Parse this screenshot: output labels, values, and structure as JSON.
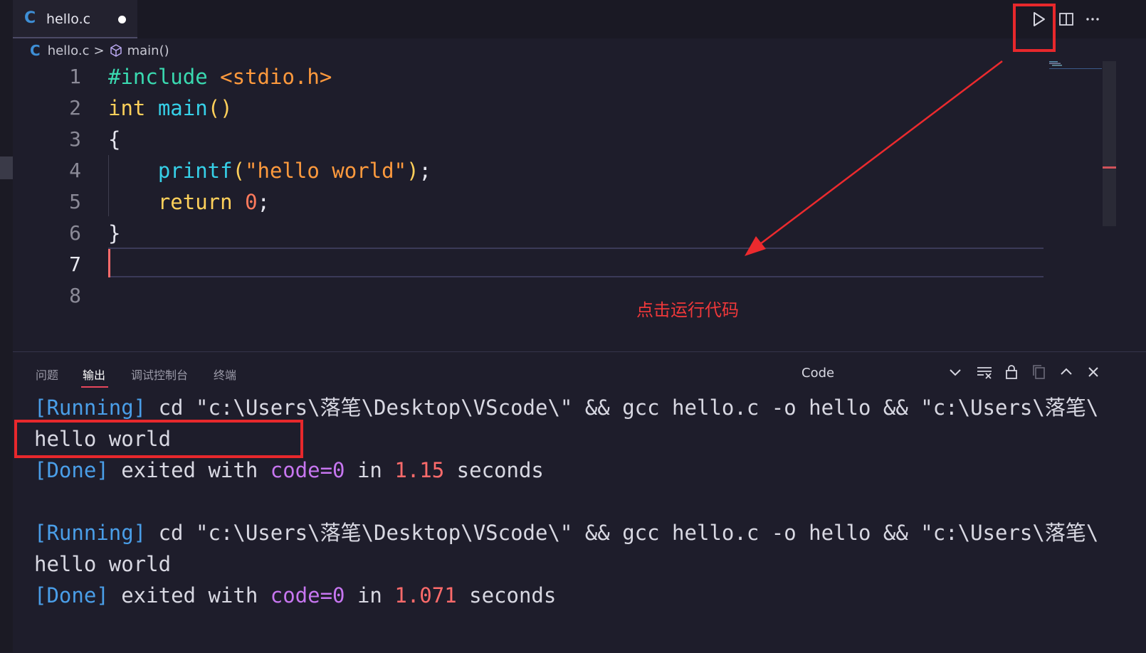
{
  "tab": {
    "file_name": "hello.c",
    "language_icon": "C"
  },
  "toolbar": {
    "run_icon": "play-icon",
    "split_icon": "split-editor-icon",
    "more_icon": "ellipsis-icon"
  },
  "breadcrumb": {
    "icon": "C",
    "file": "hello.c",
    "separator": ">",
    "symbol_icon": "cube-icon",
    "symbol": "main()"
  },
  "editor": {
    "line_numbers": [
      "1",
      "2",
      "3",
      "4",
      "5",
      "6",
      "7",
      "8"
    ],
    "active_line": "7",
    "code": {
      "l1_directive": "#include",
      "l1_header": " <stdio.h>",
      "l2_type": "int",
      "l2_fn": " main",
      "l2_parens": "()",
      "l3_brace": "{",
      "l4_indent": "    ",
      "l4_fn": "printf",
      "l4_open": "(",
      "l4_str": "\"hello world\"",
      "l4_close": ")",
      "l4_semi": ";",
      "l5_indent": "    ",
      "l5_kw": "return",
      "l5_num": " 0",
      "l5_semi": ";",
      "l6_brace": "}"
    }
  },
  "annotation": {
    "text": "点击运行代码",
    "color": "#f0383a"
  },
  "panel": {
    "tabs": [
      "问题",
      "输出",
      "调试控制台",
      "终端"
    ],
    "active_tab": "输出",
    "channel": "Code",
    "actions": [
      "chevron-down-icon",
      "clear-output-icon",
      "lock-icon",
      "copy-icon",
      "chevron-up-icon",
      "close-icon"
    ]
  },
  "output": [
    {
      "tag": "[Running]",
      "text": " cd \"c:\\Users\\落笔\\Desktop\\VScode\\\" && gcc hello.c -o hello && \"c:\\Users\\落笔\\"
    },
    {
      "text": "hello world"
    },
    {
      "tag": "[Done]",
      "pre": " exited with ",
      "code": "code=0",
      "mid": " in ",
      "time": "1.15",
      "post": " seconds"
    },
    {
      "tag": "[Running]",
      "text": " cd \"c:\\Users\\落笔\\Desktop\\VScode\\\" && gcc hello.c -o hello && \"c:\\Users\\落笔\\"
    },
    {
      "text": "hello world"
    },
    {
      "tag": "[Done]",
      "pre": " exited with ",
      "code": "code=0",
      "mid": " in ",
      "time": "1.071",
      "post": " seconds"
    }
  ],
  "colors": {
    "background": "#1e1d2b",
    "accent_red": "#e8282c",
    "tag_blue": "#4a9ee8"
  }
}
